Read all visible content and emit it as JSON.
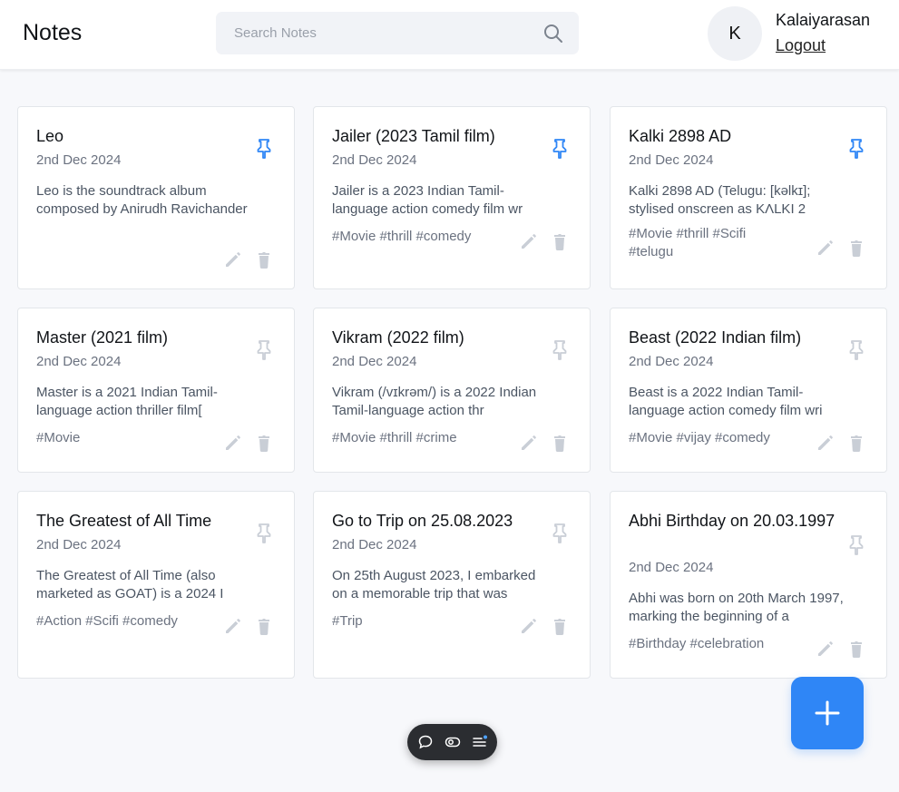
{
  "header": {
    "title": "Notes",
    "search_placeholder": "Search Notes",
    "avatar_initial": "K",
    "user_name": "Kalaiyarasan",
    "logout_label": "Logout"
  },
  "colors": {
    "accent": "#2f86f6",
    "pin_active": "#2f86f6",
    "pin_inactive": "#c9ced6",
    "action_icon": "#c9ced6"
  },
  "notes": [
    {
      "title": "Leo",
      "date": "2nd Dec 2024",
      "content": "Leo is the soundtrack album composed by Anirudh Ravichander",
      "tags": "",
      "pinned": true
    },
    {
      "title": "Jailer (2023 Tamil film)",
      "date": "2nd Dec 2024",
      "content": "Jailer is a 2023 Indian Tamil-language action comedy film wr",
      "tags": "#Movie #thrill #comedy",
      "pinned": true
    },
    {
      "title": "Kalki 2898 AD",
      "date": "2nd Dec 2024",
      "content": "Kalki 2898 AD (Telugu: [kəlkɪ]; stylised onscreen as KɅLKI 2",
      "tags": "#Movie #thrill #Scifi #telugu",
      "pinned": true
    },
    {
      "title": "Master (2021 film)",
      "date": "2nd Dec 2024",
      "content": "Master is a 2021 Indian Tamil-language action thriller film[",
      "tags": "#Movie",
      "pinned": false
    },
    {
      "title": "Vikram (2022 film)",
      "date": "2nd Dec 2024",
      "content": "Vikram (/vɪkrəm/) is a 2022 Indian Tamil-language action thr",
      "tags": "#Movie #thrill #crime",
      "pinned": false
    },
    {
      "title": "Beast (2022 Indian film)",
      "date": "2nd Dec 2024",
      "content": "Beast is a 2022 Indian Tamil-language action comedy film wri",
      "tags": "#Movie #vijay #comedy",
      "pinned": false
    },
    {
      "title": "The Greatest of All Time",
      "date": "2nd Dec 2024",
      "content": "The Greatest of All Time (also marketed as GOAT) is a 2024 I",
      "tags": "#Action #Scifi #comedy",
      "pinned": false
    },
    {
      "title": "Go to Trip on 25.08.2023",
      "date": "2nd Dec 2024",
      "content": "On 25th August 2023, I embarked on a memorable trip that was",
      "tags": "#Trip",
      "pinned": false
    },
    {
      "title": "Abhi Birthday on 20.03.1997",
      "date": "2nd Dec 2024",
      "content": "Abhi was born on 20th March 1997, marking the beginning of a",
      "tags": "#Birthday #celebration",
      "pinned": false
    }
  ],
  "fab": {
    "icon": "plus-icon"
  },
  "dock": {
    "icons": [
      "chat-icon",
      "toggle-icon",
      "menu-icon"
    ]
  }
}
